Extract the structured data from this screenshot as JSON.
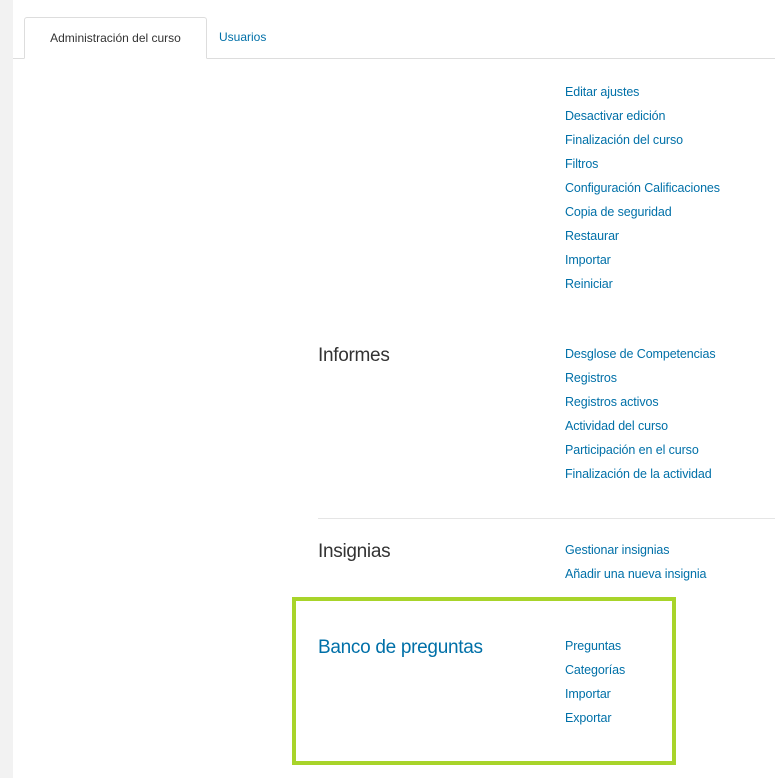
{
  "tabs": [
    {
      "label": "Administración del curso",
      "active": true
    },
    {
      "label": "Usuarios",
      "active": false
    }
  ],
  "sections": {
    "curso": {
      "links": [
        "Editar ajustes",
        "Desactivar edición",
        "Finalización del curso",
        "Filtros",
        "Configuración Calificaciones",
        "Copia de seguridad",
        "Restaurar",
        "Importar",
        "Reiniciar"
      ]
    },
    "informes": {
      "heading": "Informes",
      "links": [
        "Desglose de Competencias",
        "Registros",
        "Registros activos",
        "Actividad del curso",
        "Participación en el curso",
        "Finalización de la actividad"
      ]
    },
    "insignias": {
      "heading": "Insignias",
      "links": [
        "Gestionar insignias",
        "Añadir una nueva insignia"
      ]
    },
    "banco": {
      "heading": "Banco de preguntas",
      "links": [
        "Preguntas",
        "Categorías",
        "Importar",
        "Exportar"
      ]
    }
  },
  "colors": {
    "link": "#0070a8",
    "text": "#333333",
    "highlight": "#a8d42a"
  }
}
